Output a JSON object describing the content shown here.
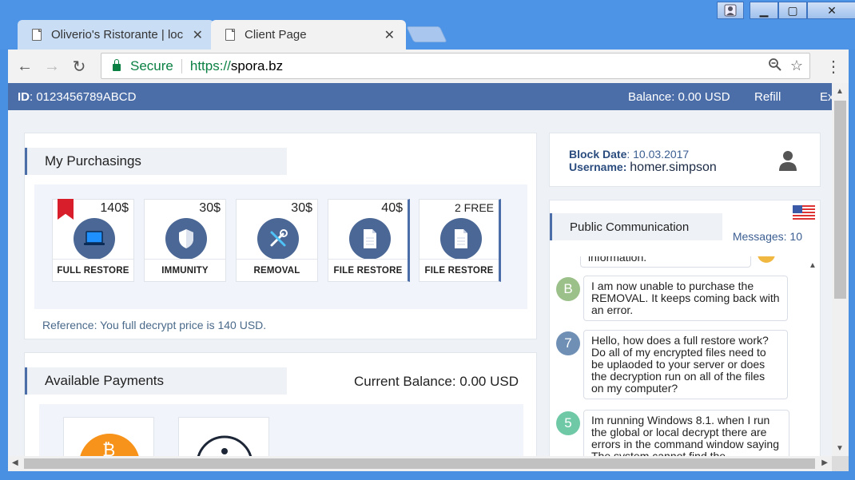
{
  "browser": {
    "tabs": [
      {
        "title": "Oliverio's Ristorante | loc",
        "active": false
      },
      {
        "title": "Client Page",
        "active": true
      }
    ],
    "secure_label": "Secure",
    "url_scheme": "https://",
    "url_host": "spora.bz"
  },
  "topbar": {
    "id_label": "ID",
    "id_value": ": 0123456789ABCD",
    "balance": "Balance: 0.00 USD",
    "refill": "Refill",
    "exit": "Ex"
  },
  "purchasings": {
    "title": "My Purchasings",
    "products": [
      {
        "price": "140$",
        "label": "FULL RESTORE",
        "icon": "laptop-icon"
      },
      {
        "price": "30$",
        "label": "IMMUNITY",
        "icon": "shield-icon"
      },
      {
        "price": "30$",
        "label": "REMOVAL",
        "icon": "tools-icon"
      },
      {
        "price": "40$",
        "label": "FILE RESTORE",
        "icon": "document-icon"
      },
      {
        "price": "2 FREE",
        "label": "FILE RESTORE",
        "icon": "document-icon"
      }
    ],
    "reference": "Reference: You full decrypt price is 140 USD."
  },
  "payments": {
    "title": "Available Payments",
    "current_balance": "Current Balance: 0.00 USD"
  },
  "account": {
    "block_date_label": "Block Date",
    "block_date_value": ": 10.03.2017",
    "username_label": "Username",
    "username_value": "homer.simpson"
  },
  "communication": {
    "title": "Public Communication",
    "messages": "Messages: 10",
    "partial_top": "information.",
    "items": [
      {
        "avatar": "B",
        "color": "#9cc08a",
        "text": "I am now unable to purchase the REMOVAL. It keeps coming back with an error."
      },
      {
        "avatar": "7",
        "color": "#6f8fb5",
        "text": "Hello, how does a full restore work? Do all of my encrypted files need to be uplaoded to your server or does the decryption run on all of the files on my computer?"
      },
      {
        "avatar": "5",
        "color": "#6fc9a6",
        "text": "Im running Windows 8.1. when I run the global or local decrypt there are errors in the command window saying The system cannot find the"
      }
    ]
  }
}
